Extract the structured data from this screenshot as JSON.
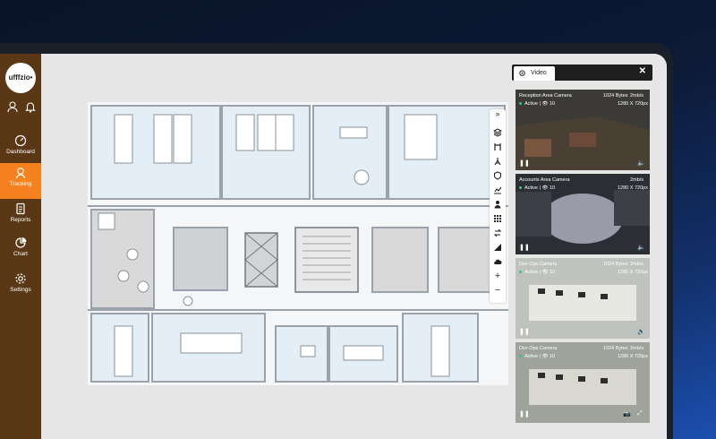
{
  "brand": {
    "logo_text": "ufffzio•"
  },
  "header_icons": [
    "user-icon",
    "bell-icon"
  ],
  "nav": [
    {
      "label": "Dashboard",
      "icon": "gauge-icon",
      "active": false
    },
    {
      "label": "Tracking",
      "icon": "location-pin-icon",
      "active": true
    },
    {
      "label": "Reports",
      "icon": "document-icon",
      "active": false
    },
    {
      "label": "Chart",
      "icon": "pie-chart-icon",
      "active": false
    },
    {
      "label": "Settings",
      "icon": "gear-icon",
      "active": false
    }
  ],
  "map_toolbar": [
    "collapse-icon",
    "layers-icon",
    "route-icon",
    "tower-icon",
    "shield-icon",
    "chart-icon",
    "person-icon",
    "grid-icon",
    "exchange-icon",
    "signal-icon",
    "cloud-icon",
    "zoom-in-icon",
    "zoom-out-icon"
  ],
  "video_panel": {
    "tab_label": "Video",
    "close_label": "✕",
    "cameras": [
      {
        "name": "Reception Area Camera",
        "bytes": "1024 Bytes",
        "rate": "2mb/s",
        "status": "Active",
        "viewers": "10",
        "resolution": "1280 X 720px"
      },
      {
        "name": "Accounts Area Camera",
        "bytes": "1024 Bytes",
        "rate": "2mb/s",
        "status": "Active",
        "viewers": "10",
        "resolution": "1280 X 720px"
      },
      {
        "name": "Dev Ops Camera",
        "bytes": "1024 Bytes",
        "rate": "2mb/s",
        "status": "Active",
        "viewers": "10",
        "resolution": "1280 X 720px"
      },
      {
        "name": "Dev Ops Camera",
        "bytes": "1024 Bytes",
        "rate": "2mb/s",
        "status": "Active",
        "viewers": "10",
        "resolution": "1280 X 720px"
      }
    ]
  },
  "colors": {
    "sidebar": "#5a3816",
    "accent": "#f5821f",
    "active_status": "#2ecc71"
  }
}
